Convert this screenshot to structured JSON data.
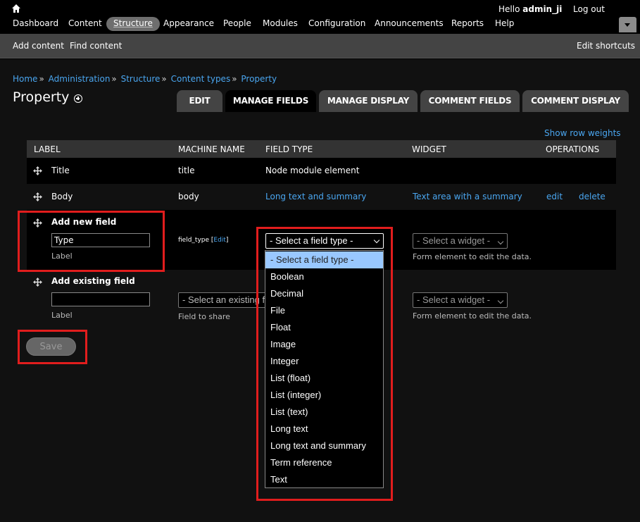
{
  "toolbar": {
    "hello_prefix": "Hello",
    "username": "admin_ji",
    "logout": "Log out",
    "menu": [
      "Dashboard",
      "Content",
      "Structure",
      "Appearance",
      "People",
      "Modules",
      "Configuration",
      "Announcements",
      "Reports",
      "Help"
    ],
    "active_menu": "Structure"
  },
  "shortcuts": {
    "add_content": "Add content",
    "find_content": "Find content",
    "edit_shortcuts": "Edit shortcuts"
  },
  "breadcrumb": [
    "Home",
    "Administration",
    "Structure",
    "Content types",
    "Property"
  ],
  "page_title": "Property",
  "tabs": [
    "EDIT",
    "MANAGE FIELDS",
    "MANAGE DISPLAY",
    "COMMENT FIELDS",
    "COMMENT DISPLAY"
  ],
  "active_tab": "MANAGE FIELDS",
  "show_row_weights": "Show row weights",
  "table": {
    "headers": [
      "LABEL",
      "MACHINE NAME",
      "FIELD TYPE",
      "WIDGET",
      "OPERATIONS"
    ],
    "rows": [
      {
        "label": "Title",
        "machine_name": "title",
        "field_type": "Node module element",
        "widget": "",
        "edit": "",
        "delete": ""
      },
      {
        "label": "Body",
        "machine_name": "body",
        "field_type": "Long text and summary",
        "widget": "Text area with a summary",
        "edit": "edit",
        "delete": "delete"
      }
    ],
    "add_new": {
      "title": "Add new field",
      "label_value": "Type",
      "label_caption": "Label",
      "machine_name": "field_type",
      "machine_edit": "Edit",
      "field_type_select": "- Select a field type -",
      "widget_select": "- Select a widget -",
      "widget_desc": "Form element to edit the data."
    },
    "add_existing": {
      "title": "Add existing field",
      "label_value": "",
      "label_caption": "Label",
      "existing_select": "- Select an existing field -",
      "existing_desc": "Field to share",
      "widget_select": "- Select a widget -",
      "widget_desc": "Form element to edit the data."
    }
  },
  "dropdown_options": [
    "- Select a field type -",
    "Boolean",
    "Decimal",
    "File",
    "Float",
    "Image",
    "Integer",
    "List (float)",
    "List (integer)",
    "List (text)",
    "Long text",
    "Long text and summary",
    "Term reference",
    "Text"
  ],
  "dropdown_selected": "- Select a field type -",
  "save_label": "Save",
  "colors": {
    "link": "#4aa6f0",
    "highlight": "#e11d1d",
    "selected_option": "#99c8ff"
  }
}
